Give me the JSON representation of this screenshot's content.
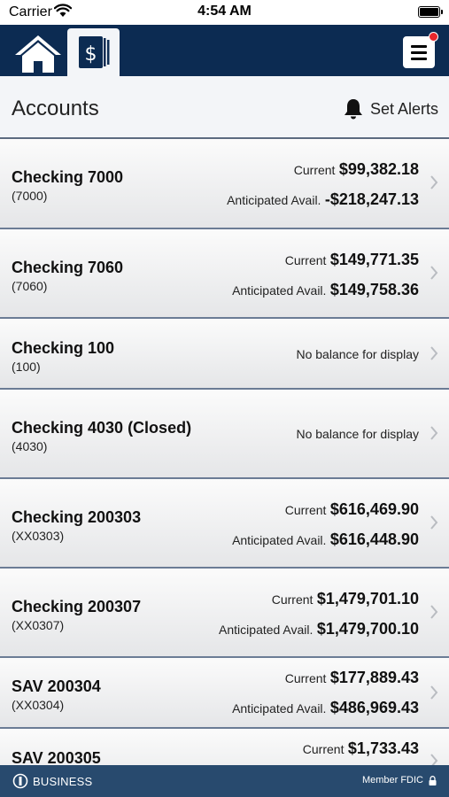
{
  "status_bar": {
    "carrier": "Carrier",
    "time": "4:54 AM"
  },
  "header": {
    "title": "Accounts",
    "alerts_label": "Set Alerts"
  },
  "labels": {
    "current": "Current",
    "anticipated": "Anticipated Avail.",
    "no_balance": "No balance for display"
  },
  "accounts": [
    {
      "name": "Checking 7000",
      "number": "(7000)",
      "current": "$99,382.18",
      "anticipated": "-$218,247.13"
    },
    {
      "name": "Checking 7060",
      "number": "(7060)",
      "current": "$149,771.35",
      "anticipated": "$149,758.36"
    },
    {
      "name": "Checking 100",
      "number": "(100)"
    },
    {
      "name": "Checking 4030 (Closed)",
      "number": "(4030)"
    },
    {
      "name": "Checking 200303",
      "number": "(XX0303)",
      "current": "$616,469.90",
      "anticipated": "$616,448.90"
    },
    {
      "name": "Checking 200307",
      "number": "(XX0307)",
      "current": "$1,479,701.10",
      "anticipated": "$1,479,700.10"
    },
    {
      "name": "SAV 200304",
      "number": "(XX0304)",
      "current": "$177,889.43",
      "anticipated": "$486,969.43"
    },
    {
      "name": "SAV 200305",
      "current": "$1,733.43"
    }
  ],
  "footer": {
    "business": "BUSINESS",
    "fdic": "Member FDIC"
  },
  "colors": {
    "nav": "#0c2b52",
    "footer": "#284a6e",
    "badge": "#e8272c"
  },
  "icons": {
    "home": "home-icon",
    "accounts": "dollar-document-icon",
    "menu": "menu-icon",
    "alerts": "bell-icon",
    "row": "chevron-right-icon",
    "lock": "lock-icon"
  }
}
